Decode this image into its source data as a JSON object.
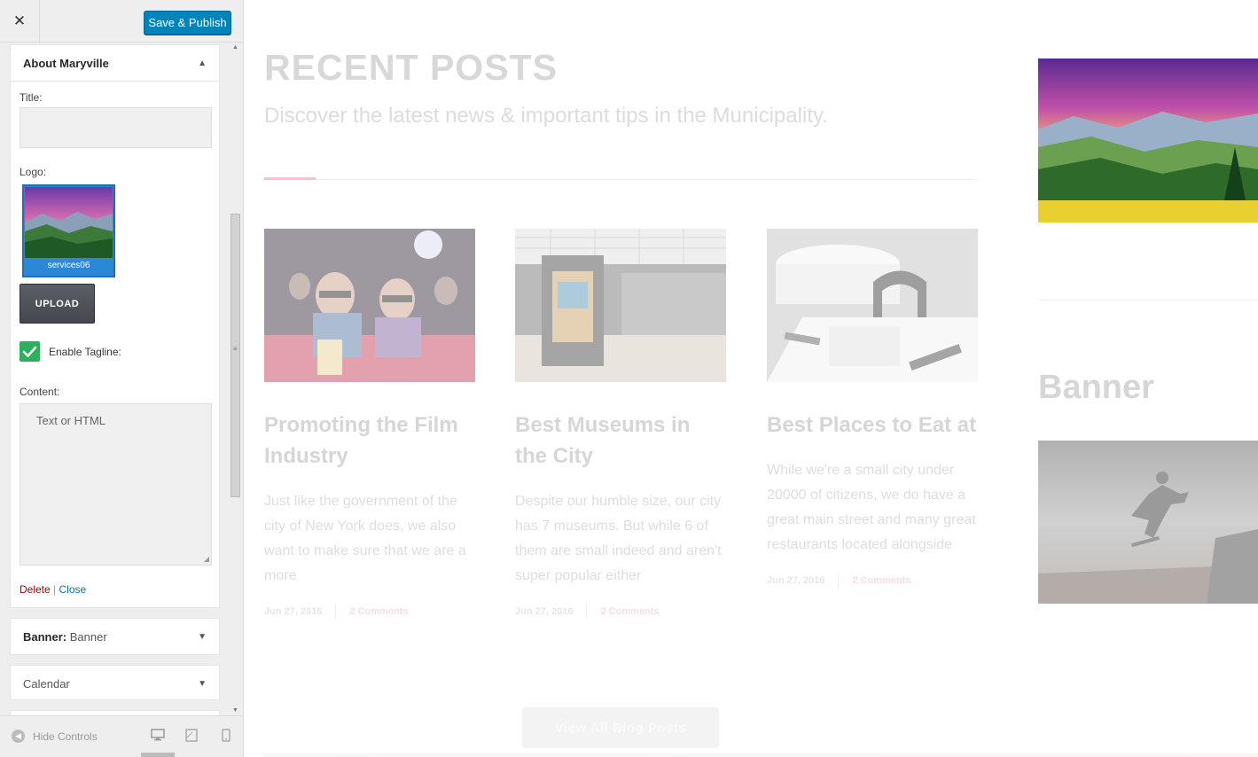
{
  "customizer": {
    "close_glyph": "✕",
    "publish_label": "Save & Publish",
    "accent_color": "#0085ba"
  },
  "about_widget": {
    "title": "About Maryville",
    "title_label": "Title:",
    "title_value": "",
    "logo_label": "Logo:",
    "logo_filename": "services06",
    "upload_label": "UPLOAD",
    "tagline_label": "Enable Tagline:",
    "tagline_checked": true,
    "content_label": "Content:",
    "content_placeholder": "Text or HTML",
    "delete_label": "Delete",
    "separator": "|",
    "close_label": "Close"
  },
  "widgets": [
    {
      "title": "Banner:",
      "subtitle": "Banner"
    },
    {
      "title": "Calendar",
      "subtitle": ""
    }
  ],
  "footer": {
    "hide_controls_label": "Hide Controls",
    "icons": [
      "desktop-icon",
      "tablet-icon",
      "mobile-icon"
    ]
  },
  "preview": {
    "recent_posts_title": "RECENT POSTS",
    "recent_posts_subtitle": "Discover the latest news & important tips in the Municipality.",
    "posts": [
      {
        "title": "Promoting the Film Industry",
        "excerpt": "Just like the government of the city of New York does, we also want to make sure that we are a more",
        "date": "Jun 27, 2016",
        "comments": "2 Comments",
        "image": "cinema-audience-photo"
      },
      {
        "title": "Best Museums in the City",
        "excerpt": "Despite our humble size, our city has 7 museums. But while 6 of them are small indeed and aren't super popular either",
        "date": "Jun 27, 2016",
        "comments": "2 Comments",
        "image": "museum-gallery-photo"
      },
      {
        "title": "Best Places to Eat at",
        "excerpt": "While we're a small city under 20000 of citizens, we do have a great main street and many great restaurants located alongside",
        "date": "Jun 27, 2016",
        "comments": "2 Comments",
        "image": "restaurant-tables-photo"
      }
    ],
    "view_all_label": "View All Blog Posts",
    "banner_heading": "Banner",
    "sidebar_images": [
      "mountain-landscape-photo",
      "skateboarder-silhouette-photo"
    ]
  }
}
